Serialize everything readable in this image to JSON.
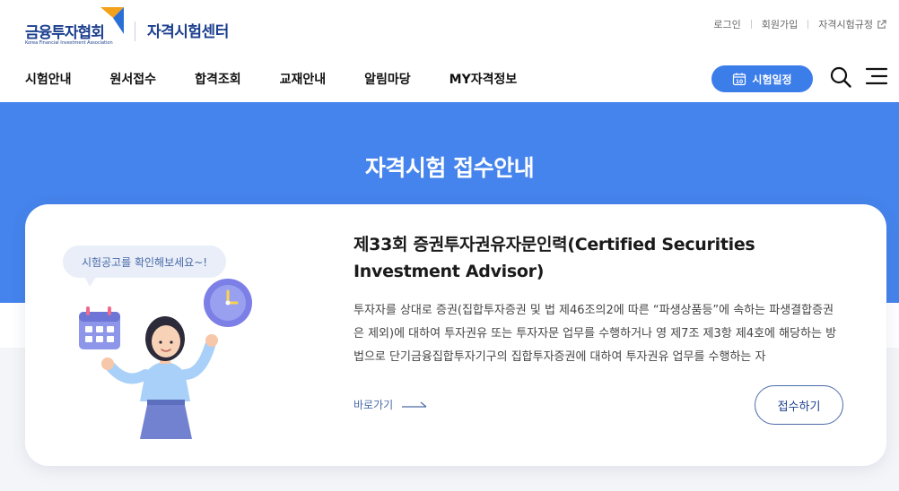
{
  "brand": {
    "org_name": "금융투자협회",
    "org_name_en": "Korea Financial Investment Association",
    "center_name": "자격시험센터",
    "colors": {
      "navy": "#1c3f8f",
      "accent": "#3b7de9",
      "hero": "#4584ec",
      "logo_orange": "#f3a11b"
    }
  },
  "util_links": [
    {
      "label": "로그인"
    },
    {
      "label": "회원가입"
    },
    {
      "label": "자격시험규정",
      "icon": "external-link-icon"
    }
  ],
  "nav": [
    {
      "label": "시험안내"
    },
    {
      "label": "원서접수"
    },
    {
      "label": "합격조회"
    },
    {
      "label": "교재안내"
    },
    {
      "label": "알림마당"
    },
    {
      "label": "MY자격정보"
    }
  ],
  "header_actions": {
    "schedule_label": "시험일정",
    "schedule_icon": "calendar-icon",
    "schedule_icon_number": "10",
    "search_icon": "search-icon",
    "menu_icon": "hamburger-menu-icon"
  },
  "hero": {
    "title": "자격시험 접수안내"
  },
  "card": {
    "bubble_text": "시험공고를 확인해보세요~!",
    "exam_title": "제33회 증권투자권유자문인력(Certified Securities Investment Advisor)",
    "description": "투자자를 상대로 증권(집합투자증권 및 법 제46조의2에 따른 “파생상품등”에 속하는 파생결합증권은 제외)에 대하여 투자권유 또는 투자자문 업무를 수행하거나 영 제7조 제3항 제4호에 해당하는 방법으로 단기금융집합투자기구의 집합투자증권에 대하여 투자권유 업무를 수행하는 자",
    "go_link_label": "바로가기",
    "apply_label": "접수하기"
  }
}
